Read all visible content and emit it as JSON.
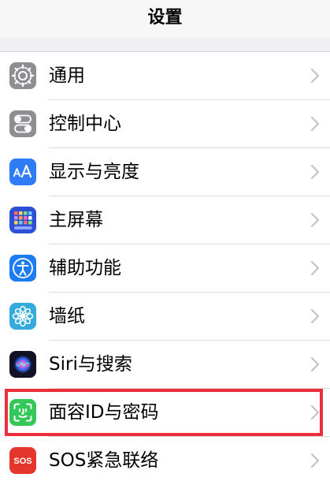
{
  "header": {
    "title": "设置"
  },
  "settings_list": {
    "items": [
      {
        "label": "通用",
        "icon": "gear-icon"
      },
      {
        "label": "控制中心",
        "icon": "toggle-switches-icon"
      },
      {
        "label": "显示与亮度",
        "icon": "text-size-icon"
      },
      {
        "label": "主屏幕",
        "icon": "app-grid-icon"
      },
      {
        "label": "辅助功能",
        "icon": "accessibility-icon"
      },
      {
        "label": "墙纸",
        "icon": "flower-icon"
      },
      {
        "label": "Siri与搜索",
        "icon": "siri-icon"
      },
      {
        "label": "面容ID与密码",
        "icon": "face-id-icon"
      },
      {
        "label": "SOS紧急联络",
        "icon": "sos-icon"
      }
    ]
  },
  "colors": {
    "highlight_border": "#ee2d3a",
    "general_icon_bg": "#8e8e93",
    "display_icon_bg": "#2f7cf6",
    "home_icon_bg": "#2c4fd6",
    "accessibility_icon_bg": "#1e7cf2",
    "wallpaper_icon_bg": "#35aadc",
    "faceid_icon_bg": "#34c759",
    "sos_icon_bg": "#e5362d"
  }
}
